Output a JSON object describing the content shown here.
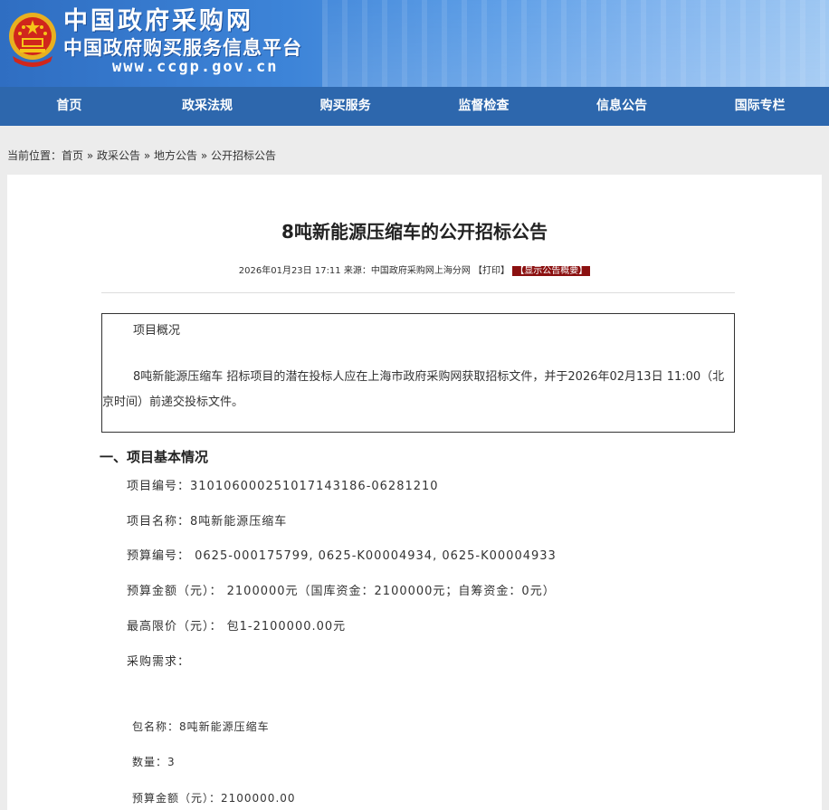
{
  "header": {
    "site_name": "中国政府采购网",
    "site_subname": "中国政府购买服务信息平台",
    "site_url": "www.ccgp.gov.cn"
  },
  "nav": [
    "首页",
    "政采法规",
    "购买服务",
    "监督检查",
    "信息公告",
    "国际专栏"
  ],
  "breadcrumb": {
    "label": "当前位置：",
    "items": [
      "首页",
      "政采公告",
      "地方公告",
      "公开招标公告"
    ],
    "sep": " » "
  },
  "article": {
    "title": "8吨新能源压缩车的公开招标公告",
    "meta": {
      "datetime": "2026年01月23日 17:11",
      "source_label": "来源：",
      "source": "中国政府采购网上海分网",
      "print": "【打印】",
      "show_summary": "【显示公告概要】"
    },
    "summary": {
      "title": "项目概况",
      "text": "8吨新能源压缩车 招标项目的潜在投标人应在上海市政府采购网获取招标文件，并于2026年02月13日 11:00（北京时间）前递交投标文件。"
    },
    "section1_heading": "一、项目基本情况",
    "fields": [
      "项目编号：310106000251017143186-06281210",
      "项目名称：8吨新能源压缩车",
      "预算编号： 0625-000175799, 0625-K00004934, 0625-K00004933",
      "预算金额（元）： 2100000元（国库资金：2100000元；自筹资金：0元）",
      "最高限价（元）： 包1-2100000.00元",
      "采购需求："
    ],
    "package": [
      "包名称：8吨新能源压缩车",
      "数量：3",
      "预算金额（元）：2100000.00"
    ]
  }
}
